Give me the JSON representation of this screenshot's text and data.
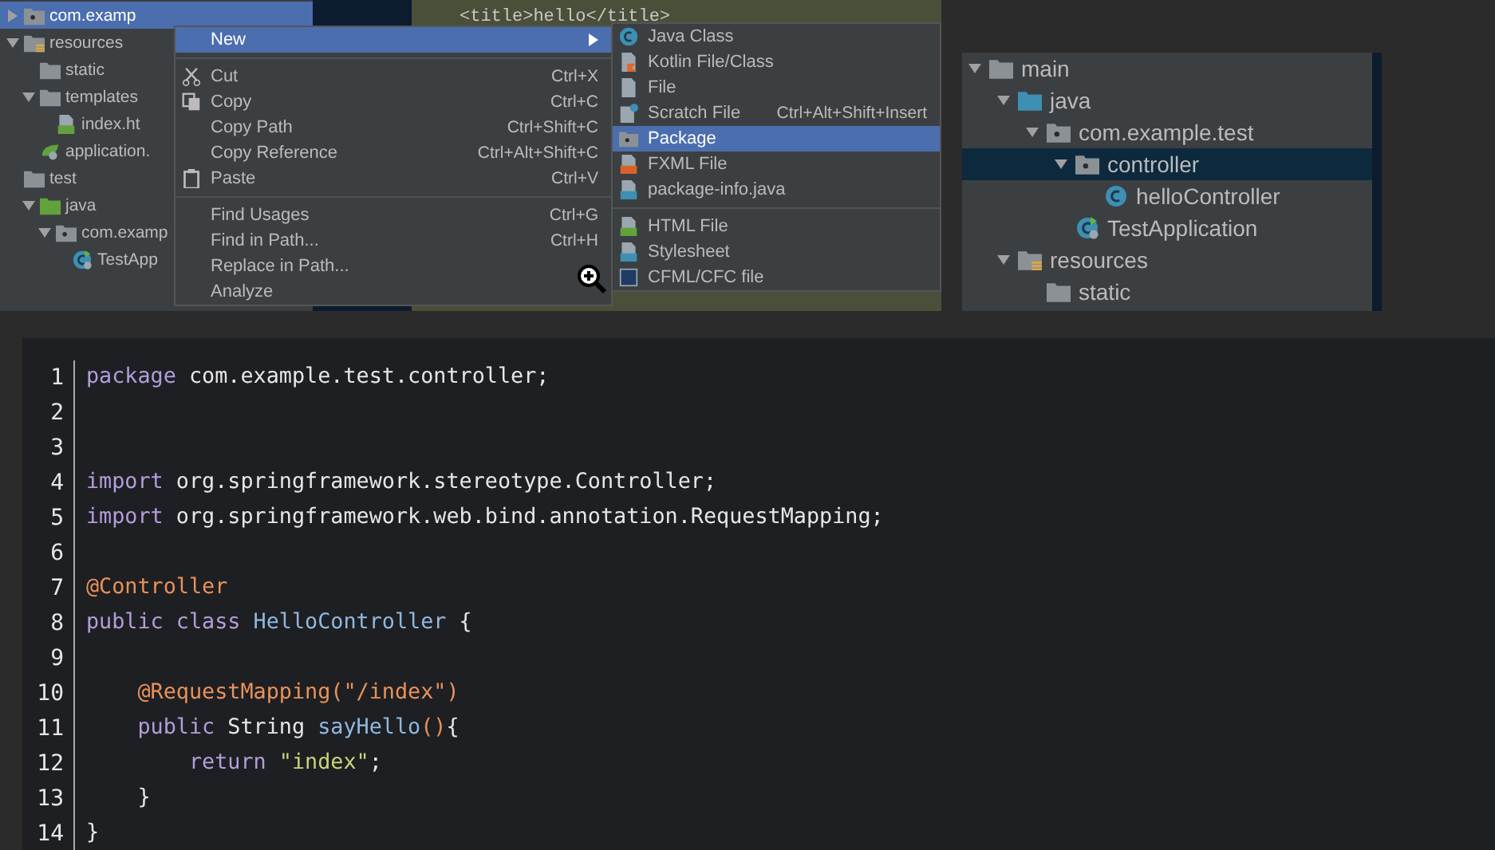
{
  "ide_left": {
    "project_tree": [
      {
        "label": "com.examp",
        "kind": "package",
        "expanded": false,
        "selected": true
      },
      {
        "label": "resources",
        "kind": "resources",
        "expanded": true,
        "selected": false,
        "children": [
          {
            "label": "static",
            "kind": "folder",
            "selected": false
          },
          {
            "label": "templates",
            "kind": "folder",
            "expanded": true,
            "selected": false,
            "children": [
              {
                "label": "index.ht",
                "kind": "html",
                "selected": false
              }
            ]
          },
          {
            "label": "application.",
            "kind": "config",
            "selected": false
          }
        ]
      },
      {
        "label": "test",
        "kind": "plain",
        "selected": false,
        "children": [
          {
            "label": "java",
            "kind": "testsrc",
            "expanded": true,
            "selected": false,
            "children": [
              {
                "label": "com.examp",
                "kind": "package",
                "expanded": true,
                "selected": false,
                "children": [
                  {
                    "label": "TestApp",
                    "kind": "appclass",
                    "selected": false
                  }
                ]
              }
            ]
          }
        ]
      }
    ],
    "editor_text": "<title>hello</title>",
    "context_menu": [
      {
        "label": "New",
        "kind": "submenu",
        "selected": true
      },
      {
        "kind": "separator"
      },
      {
        "label": "Cut",
        "shortcut": "Ctrl+X",
        "kind": "scissors",
        "selected": false
      },
      {
        "label": "Copy",
        "shortcut": "Ctrl+C",
        "kind": "copy",
        "selected": false
      },
      {
        "label": "Copy Path",
        "shortcut": "Ctrl+Shift+C",
        "kind": "plain",
        "selected": false
      },
      {
        "label": "Copy Reference",
        "shortcut": "Ctrl+Alt+Shift+C",
        "kind": "plain",
        "selected": false
      },
      {
        "label": "Paste",
        "shortcut": "Ctrl+V",
        "kind": "clipboard",
        "selected": false
      },
      {
        "kind": "separator"
      },
      {
        "label": "Find Usages",
        "shortcut": "Ctrl+G",
        "kind": "plain",
        "selected": false
      },
      {
        "label": "Find in Path...",
        "shortcut": "Ctrl+H",
        "kind": "plain",
        "selected": false
      },
      {
        "label": "Replace in Path...",
        "kind": "plain",
        "selected": false
      },
      {
        "label": "Analyze",
        "kind": "plain",
        "selected": false
      }
    ],
    "submenu": [
      {
        "label": "Java Class",
        "kind": "class",
        "selected": false
      },
      {
        "label": "Kotlin File/Class",
        "kind": "kotlin",
        "selected": false
      },
      {
        "label": "File",
        "kind": "file",
        "selected": false
      },
      {
        "label": "Scratch File",
        "shortcut": "Ctrl+Alt+Shift+Insert",
        "kind": "scratch",
        "selected": false
      },
      {
        "label": "Package",
        "kind": "package",
        "selected": true
      },
      {
        "label": "FXML File",
        "kind": "fxml",
        "selected": false
      },
      {
        "label": "package-info.java",
        "kind": "javafile",
        "selected": false
      },
      {
        "kind": "separator"
      },
      {
        "label": "HTML File",
        "kind": "html",
        "selected": false
      },
      {
        "label": "Stylesheet",
        "kind": "css",
        "selected": false
      },
      {
        "label": "CFML/CFC file",
        "kind": "cfml",
        "selected": false
      }
    ]
  },
  "ide_right": {
    "project_tree": [
      {
        "label": "main",
        "kind": "folder",
        "expanded": true,
        "selected": false,
        "children": [
          {
            "label": "java",
            "kind": "source",
            "expanded": true,
            "selected": false,
            "children": [
              {
                "label": "com.example.test",
                "kind": "package",
                "expanded": true,
                "selected": false,
                "children": [
                  {
                    "label": "controller",
                    "kind": "package",
                    "expanded": true,
                    "selected": true,
                    "children": [
                      {
                        "label": "helloController",
                        "kind": "class",
                        "selected": false
                      }
                    ]
                  },
                  {
                    "label": "TestApplication",
                    "kind": "appclass",
                    "selected": false
                  }
                ]
              }
            ]
          },
          {
            "label": "resources",
            "kind": "resources",
            "expanded": true,
            "selected": false,
            "children": [
              {
                "label": "static",
                "kind": "folder",
                "selected": false
              }
            ]
          }
        ]
      }
    ]
  },
  "code_block": {
    "lines": [
      {
        "number": "1",
        "tokens": [
          {
            "text": "package",
            "kind": "keyword"
          },
          {
            "text": " com.example.test.controller;",
            "kind": "plain"
          }
        ]
      },
      {
        "number": "2"
      },
      {
        "number": "3"
      },
      {
        "number": "4",
        "tokens": [
          {
            "text": "import",
            "kind": "keyword"
          },
          {
            "text": " org.springframework.stereotype.Controller;",
            "kind": "plain"
          }
        ]
      },
      {
        "number": "5",
        "tokens": [
          {
            "text": "import",
            "kind": "keyword"
          },
          {
            "text": " org.springframework.web.bind.annotation.RequestMapping;",
            "kind": "plain"
          }
        ]
      },
      {
        "number": "6"
      },
      {
        "number": "7",
        "tokens": [
          {
            "text": "@Controller",
            "kind": "annotation"
          }
        ]
      },
      {
        "number": "8",
        "tokens": [
          {
            "text": "public class",
            "kind": "keyword"
          },
          {
            "text": " HelloController",
            "kind": "name"
          },
          {
            "text": " {",
            "kind": "plain"
          }
        ]
      },
      {
        "number": "9"
      },
      {
        "number": "10",
        "tokens": [
          {
            "text": "    @RequestMapping(\"/index\")",
            "kind": "annotation"
          }
        ]
      },
      {
        "number": "11",
        "tokens": [
          {
            "text": "    public",
            "kind": "keyword"
          },
          {
            "text": " String ",
            "kind": "plain"
          },
          {
            "text": "sayHello",
            "kind": "name"
          },
          {
            "text": "()",
            "kind": "annotation"
          },
          {
            "text": "{",
            "kind": "plain"
          }
        ]
      },
      {
        "number": "12",
        "tokens": [
          {
            "text": "        return",
            "kind": "keyword"
          },
          {
            "text": " \"index\"",
            "kind": "string"
          },
          {
            "text": ";",
            "kind": "plain"
          }
        ]
      },
      {
        "number": "13",
        "tokens": [
          {
            "text": "    }",
            "kind": "plain"
          }
        ]
      },
      {
        "number": "14",
        "tokens": [
          {
            "text": "}",
            "kind": "plain"
          }
        ]
      }
    ]
  }
}
